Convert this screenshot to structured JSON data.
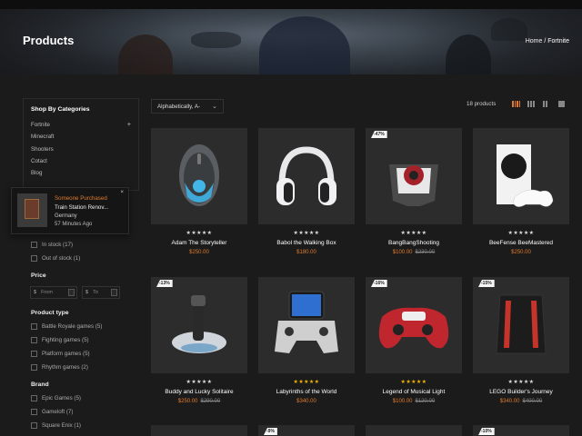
{
  "header": {
    "title": "Products",
    "breadcrumb": {
      "home": "Home",
      "sep": "/",
      "current": "Fortnite"
    }
  },
  "sidebar": {
    "categories_title": "Shop By Categories",
    "categories": [
      "Fortnite",
      "Minecraft",
      "Shooters",
      "Cotact",
      "Blog"
    ],
    "expand_icon": "plus-icon",
    "availability": [
      "In stock (17)",
      "Out of stock (1)"
    ],
    "price_title": "Price",
    "price_from": {
      "currency": "$",
      "placeholder": "From"
    },
    "price_to": {
      "currency": "$",
      "placeholder": "To"
    },
    "product_type_title": "Product type",
    "product_types": [
      "Battle Royale games (5)",
      "Fighting games (5)",
      "Platform games (5)",
      "Rhythm games (2)"
    ],
    "brand_title": "Brand",
    "brands": [
      "Epic Games (5)",
      "Gameloft (7)",
      "Square Enix (1)"
    ]
  },
  "popup": {
    "line1": "Someone Purchased",
    "product": "Train Station Renov...",
    "country": "Germany",
    "time": "57 Minutes Ago",
    "close": "×"
  },
  "toolbar": {
    "sort_label": "Alphabetically, A-",
    "sort_icon": "chevron-down-icon",
    "count": "18 products",
    "active_color": "#e07a2e"
  },
  "products": [
    {
      "name": "Adam The Storyteller",
      "stars": "★★★★★",
      "price": "$250.00",
      "old": "",
      "badge": ""
    },
    {
      "name": "Babol the Walking Box",
      "stars": "★★★★★",
      "price": "$180.00",
      "old": "",
      "badge": ""
    },
    {
      "name": "BangBangShooting",
      "stars": "★★★★★",
      "price": "$100.00",
      "old": "$230.00",
      "badge": "-47%"
    },
    {
      "name": "BeeFense BeeMastered",
      "stars": "★★★★★",
      "price": "$250.00",
      "old": "",
      "badge": ""
    },
    {
      "name": "Buddy and Lucky Solitaire",
      "stars": "★★★★★",
      "price": "$250.00",
      "old": "$290.00",
      "badge": "-13%"
    },
    {
      "name": "Labyrinths of the World",
      "stars": "★★★★★",
      "price": "$340.00",
      "old": "",
      "badge": ""
    },
    {
      "name": "Legend of Musical Light",
      "stars": "★★★★★",
      "price": "$100.00",
      "old": "$120.00",
      "badge": "-16%"
    },
    {
      "name": "LEGO Builder's Journey",
      "stars": "★★★★★",
      "price": "$340.00",
      "old": "$400.00",
      "badge": "-15%"
    }
  ],
  "partial_badges": [
    "-9%",
    "-10%"
  ]
}
